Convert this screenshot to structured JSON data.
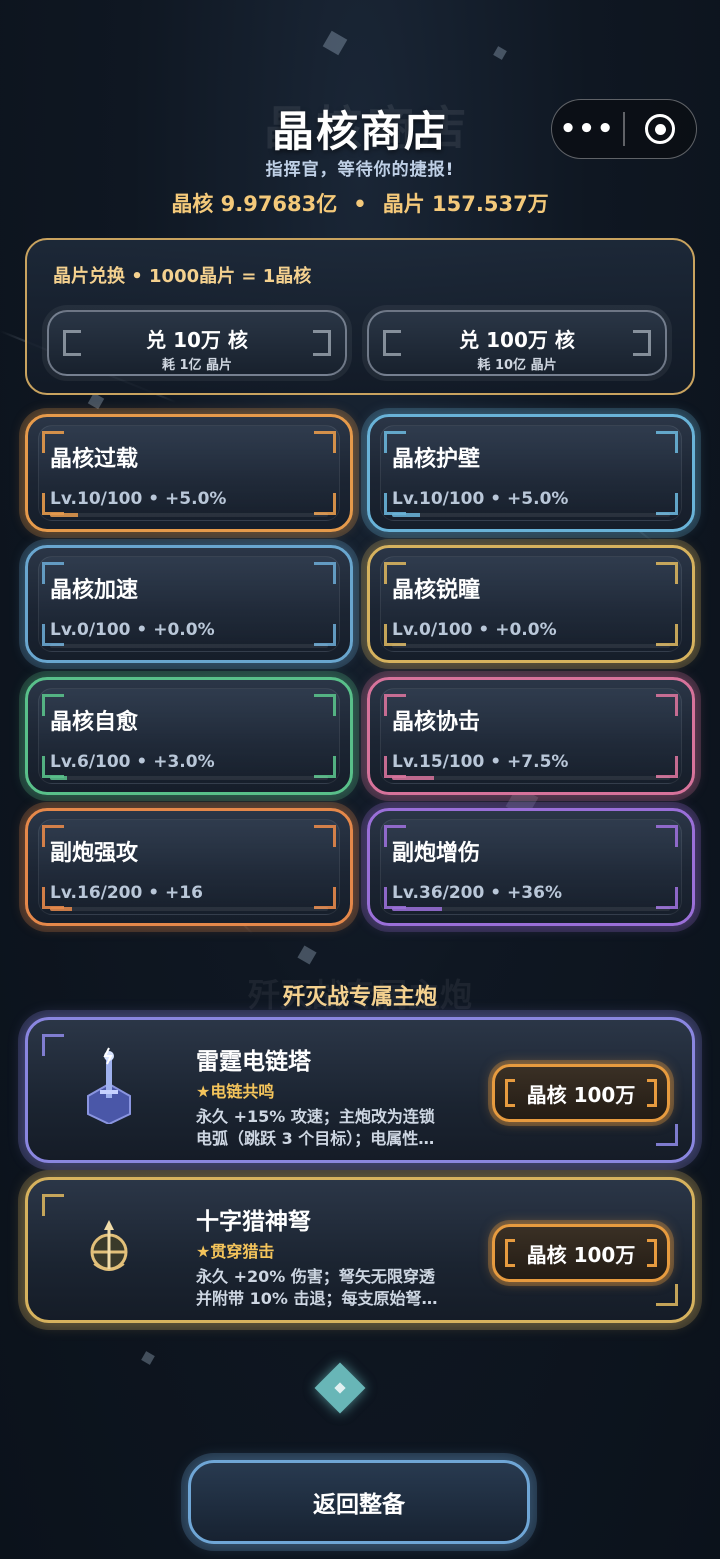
{
  "header": {
    "title": "晶核商店",
    "subtitle": "指挥官，等待你的捷报!",
    "core_balance": "晶核 9.97683亿",
    "shard_balance": "晶片 157.537万",
    "separator": "•",
    "menu_more": "•••"
  },
  "exchange": {
    "label": "晶片兑换 • 1000晶片 = 1晶核",
    "buttons": [
      {
        "main": "兑 10万 核",
        "sub": "耗 1亿 晶片"
      },
      {
        "main": "兑 100万 核",
        "sub": "耗 10亿 晶片"
      }
    ]
  },
  "upgrades": [
    {
      "name": "晶核过载",
      "level": "Lv.10/100 • +5.0%",
      "color": "#e69a4b",
      "progress": 0.1
    },
    {
      "name": "晶核护壁",
      "level": "Lv.10/100 • +5.0%",
      "color": "#69b3d8",
      "progress": 0.1
    },
    {
      "name": "晶核加速",
      "level": "Lv.0/100 • +0.0%",
      "color": "#69a6cf",
      "progress": 0.0
    },
    {
      "name": "晶核锐瞳",
      "level": "Lv.0/100 • +0.0%",
      "color": "#d6b25e",
      "progress": 0.0
    },
    {
      "name": "晶核自愈",
      "level": "Lv.6/100 • +3.0%",
      "color": "#59c08a",
      "progress": 0.06
    },
    {
      "name": "晶核协击",
      "level": "Lv.15/100 • +7.5%",
      "color": "#d7739b",
      "progress": 0.15
    },
    {
      "name": "副炮强攻",
      "level": "Lv.16/200 • +16",
      "color": "#e5884a",
      "progress": 0.08
    },
    {
      "name": "副炮增伤",
      "level": "Lv.36/200 • +36%",
      "color": "#9a6fd8",
      "progress": 0.18
    }
  ],
  "section": {
    "title": "歼灭战专属主炮"
  },
  "weapons": [
    {
      "name": "雷霆电链塔",
      "tag": "★电链共鸣",
      "desc1": "永久 +15% 攻速；主炮改为连锁",
      "desc2": "电弧（跳跃 3 个目标）；电属性…",
      "price": "晶核 100万",
      "color": "#8a86e0",
      "icon": "tesla-tower-icon"
    },
    {
      "name": "十字猎神弩",
      "tag": "★贯穿猎击",
      "desc1": "永久 +20% 伤害；弩矢无限穿透",
      "desc2": "并附带 10% 击退；每支原始弩…",
      "price": "晶核 100万",
      "color": "#d6b25e",
      "icon": "crossbow-icon"
    }
  ],
  "footer": {
    "back_label": "返回整备"
  }
}
